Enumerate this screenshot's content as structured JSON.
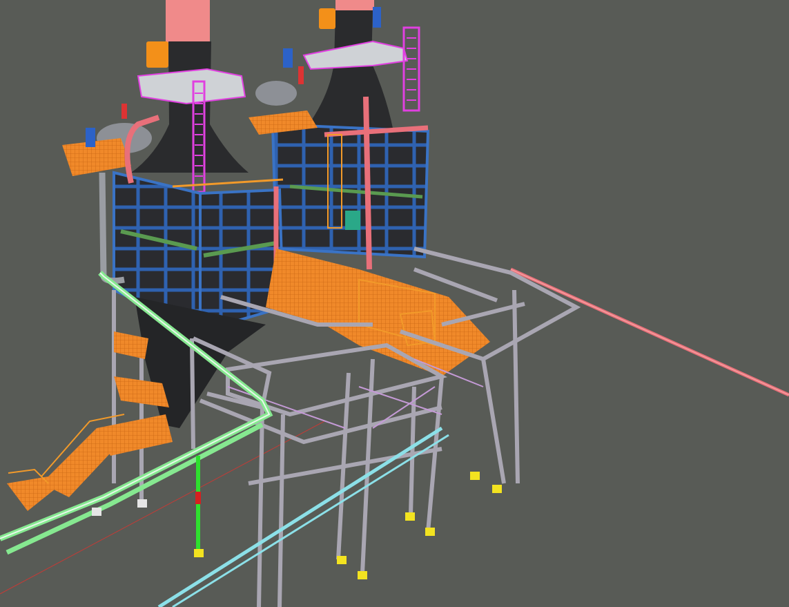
{
  "viewport": {
    "view_mode": "3D shaded",
    "background_color": "#585b56"
  },
  "scene": {
    "structures": [
      {
        "id": "heater-1",
        "parts": [
          "stack",
          "convection-box",
          "radiant-hopper",
          "platforms",
          "ladder",
          "steam-drum"
        ]
      },
      {
        "id": "heater-2",
        "parts": [
          "stack",
          "convection-box",
          "platforms",
          "ladder",
          "steam-drum"
        ]
      },
      {
        "id": "pipe-rack",
        "parts": [
          "steel-frame",
          "deck",
          "stairs"
        ]
      }
    ],
    "colors": {
      "stack_tip": "#f08a8a",
      "stack_body": "#2a2b2d",
      "casing": "#2f5fa8",
      "casing_panel": "#2c2d30",
      "platform": "#f28a1c",
      "handrail": "#f29a2a",
      "ladder": "#e040e0",
      "steel": "#a9a6b2",
      "pipe_red": "#e8707a",
      "pipe_green": "#86e890",
      "pipe_cyan": "#8ce0e8",
      "pipe_purple": "#c49ad6",
      "baseplate": "#f3e320",
      "axis_red": "#c43b36",
      "axis_green": "#2ee02e"
    }
  }
}
